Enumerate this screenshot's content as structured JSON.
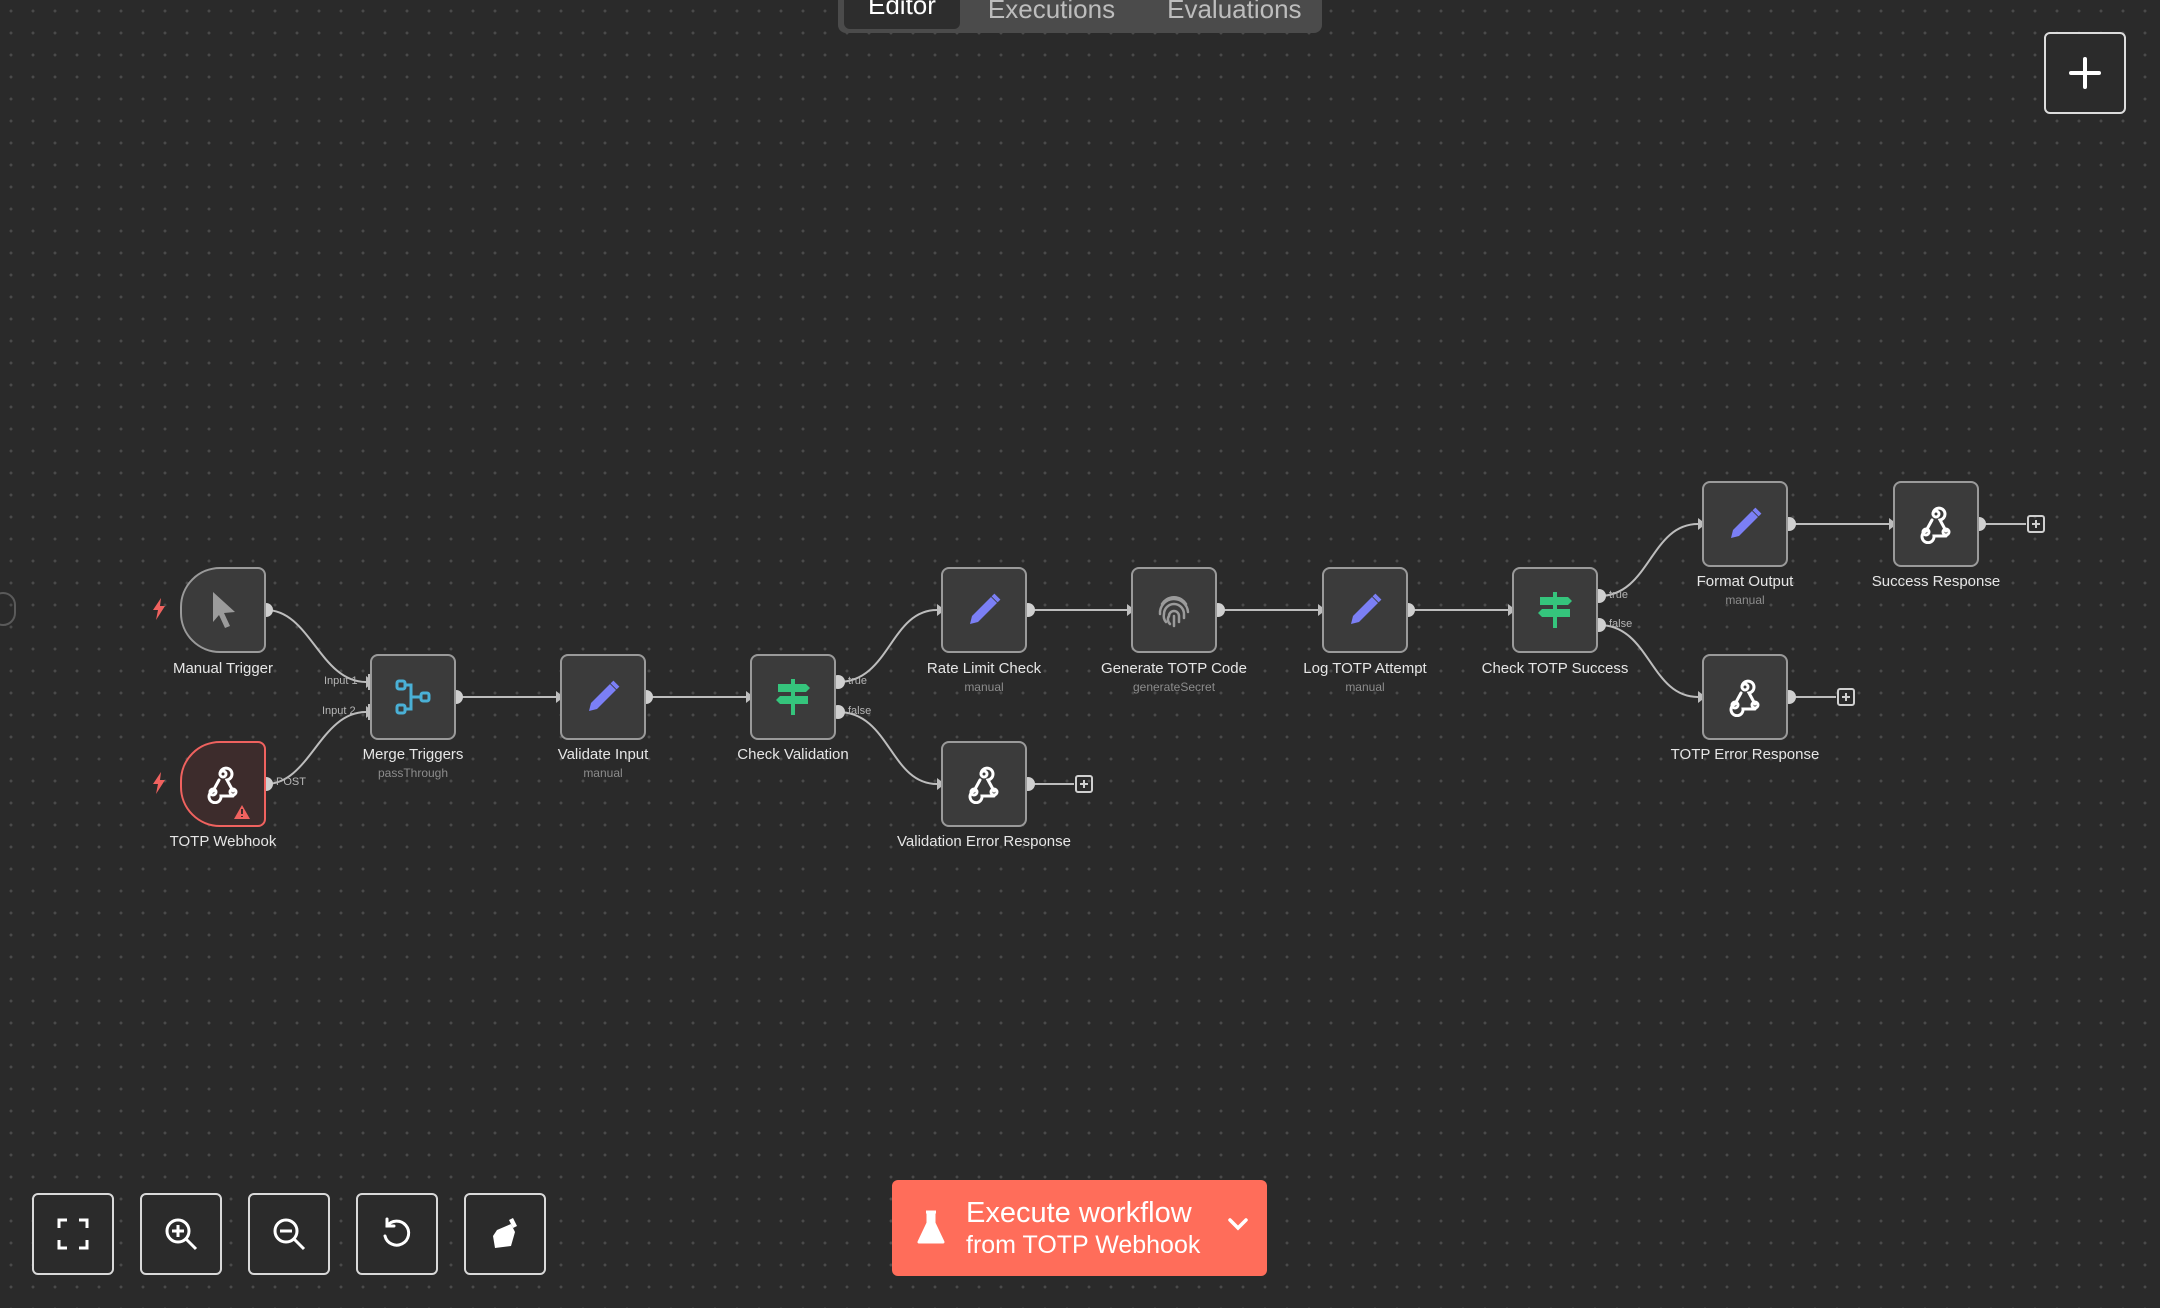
{
  "tabs": [
    "Editor",
    "Executions",
    "Evaluations"
  ],
  "nodes": {
    "manual_trigger": {
      "label": "Manual Trigger",
      "icon": "cursor-icon"
    },
    "totp_webhook": {
      "label": "TOTP Webhook",
      "icon": "webhook-icon",
      "port": "POST"
    },
    "merge_triggers": {
      "label": "Merge Triggers",
      "sub": "passThrough",
      "icon": "merge-icon",
      "in1": "Input 1",
      "in2": "Input 2"
    },
    "validate_input": {
      "label": "Validate Input",
      "sub": "manual",
      "icon": "pencil-icon"
    },
    "check_validation": {
      "label": "Check Validation",
      "icon": "signpost-icon",
      "true": "true",
      "false": "false"
    },
    "rate_limit_check": {
      "label": "Rate Limit Check",
      "sub": "manual",
      "icon": "pencil-icon"
    },
    "validation_error_response": {
      "label": "Validation Error Response",
      "icon": "webhook-icon"
    },
    "generate_totp_code": {
      "label": "Generate TOTP Code",
      "sub": "generateSecret",
      "icon": "fingerprint-icon"
    },
    "log_totp_attempt": {
      "label": "Log TOTP Attempt",
      "sub": "manual",
      "icon": "pencil-icon"
    },
    "check_totp_success": {
      "label": "Check TOTP Success",
      "icon": "signpost-icon",
      "true": "true",
      "false": "false"
    },
    "format_output": {
      "label": "Format Output",
      "sub": "manual",
      "icon": "pencil-icon"
    },
    "success_response": {
      "label": "Success Response",
      "icon": "webhook-icon"
    },
    "totp_error_response": {
      "label": "TOTP Error Response",
      "icon": "webhook-icon"
    }
  },
  "controls": [
    "fit-view-icon",
    "zoom-in-icon",
    "zoom-out-icon",
    "reset-zoom-icon",
    "tidy-up-icon"
  ],
  "execute": {
    "line1": "Execute workflow",
    "line2": "from TOTP Webhook"
  },
  "colors": {
    "accent": "#ff6d5a",
    "pencil": "#7b7ff5",
    "signpost": "#35c47c",
    "merge": "#4ab0d6",
    "error": "#f0625f"
  }
}
